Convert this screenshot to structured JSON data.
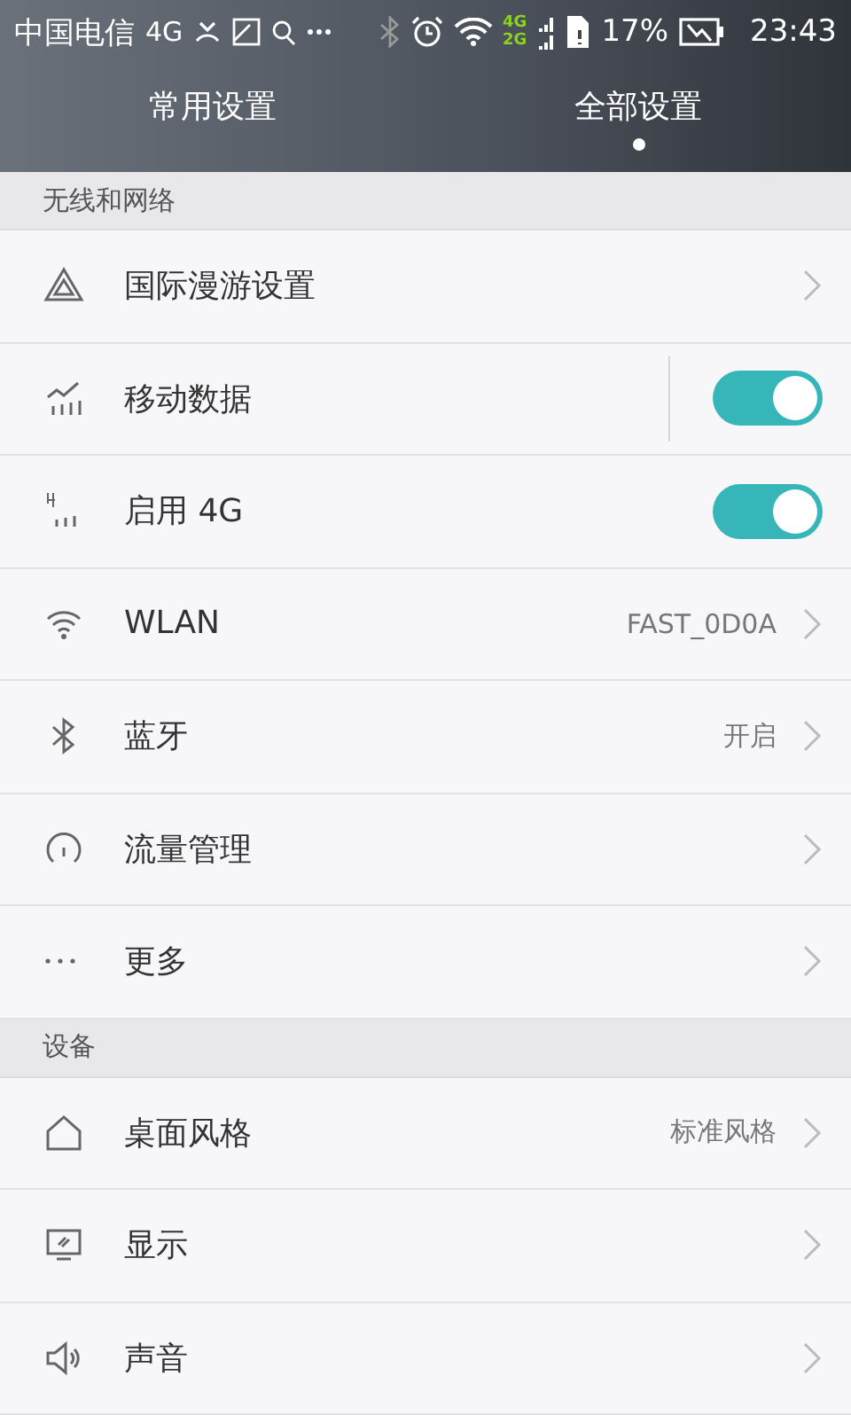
{
  "status_bar": {
    "carrier": "中国电信",
    "network": "4G",
    "signal_labels": [
      "4G",
      "2G"
    ],
    "battery": "17%",
    "time": "23:43"
  },
  "tabs": [
    {
      "label": "常用设置",
      "selected": false
    },
    {
      "label": "全部设置",
      "selected": true
    }
  ],
  "sections": [
    {
      "title": "无线和网络",
      "items": [
        {
          "kind": "link",
          "label": "国际漫游设置"
        },
        {
          "kind": "toggle",
          "label": "移动数据",
          "on": true,
          "divider": true
        },
        {
          "kind": "toggle",
          "label": "启用 4G",
          "on": true
        },
        {
          "kind": "link",
          "label": "WLAN",
          "value": "FAST_0D0A"
        },
        {
          "kind": "link",
          "label": "蓝牙",
          "value": "开启"
        },
        {
          "kind": "link",
          "label": "流量管理"
        },
        {
          "kind": "link",
          "label": "更多"
        }
      ]
    },
    {
      "title": "设备",
      "items": [
        {
          "kind": "link",
          "label": "桌面风格",
          "value": "标准风格"
        },
        {
          "kind": "link",
          "label": "显示"
        },
        {
          "kind": "link",
          "label": "声音"
        }
      ]
    }
  ]
}
